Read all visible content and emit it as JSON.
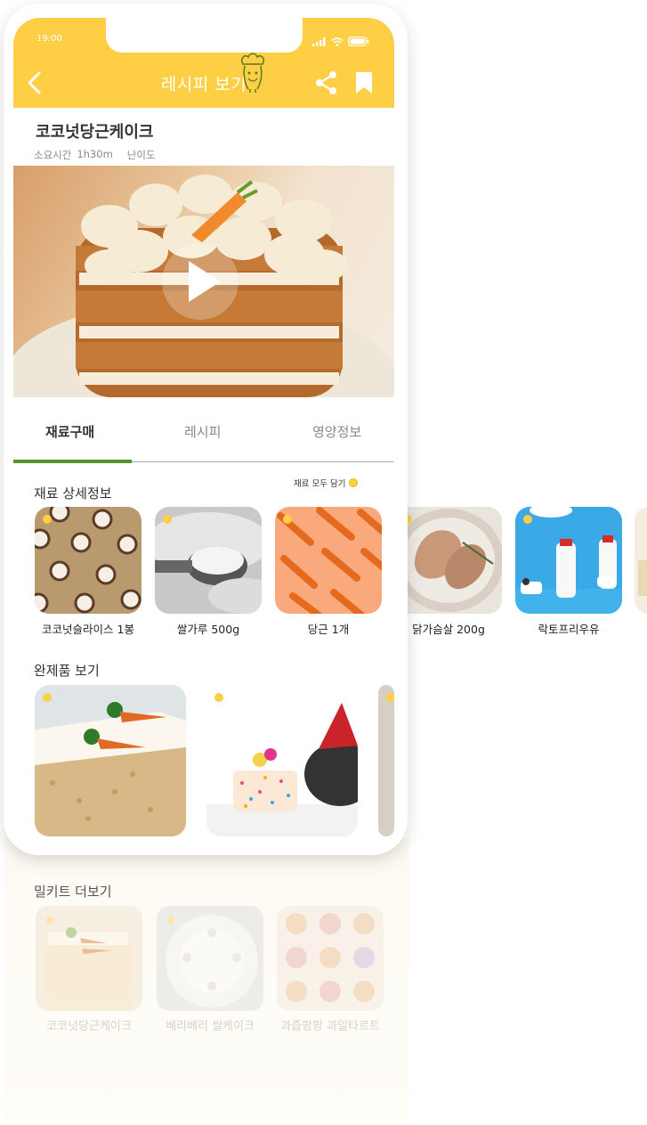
{
  "status_bar": {
    "time": "19:00"
  },
  "app_bar": {
    "title": "레시피 보기"
  },
  "recipe": {
    "title": "코코넛당근케이크",
    "time_label": "소요시간",
    "time_value": "1h30m",
    "difficulty_label": "난이도"
  },
  "tabs": [
    {
      "label": "재료구매",
      "active": true
    },
    {
      "label": "레시피",
      "active": false
    },
    {
      "label": "영양정보",
      "active": false
    }
  ],
  "ingredients": {
    "title": "재료 상세정보",
    "add_all_label": "재료 모두 담기",
    "items": [
      {
        "label": "코코넛슬라이스 1봉",
        "image": "coconut-slices"
      },
      {
        "label": "쌀가루 500g",
        "image": "rice-flour"
      },
      {
        "label": "당근 1개",
        "image": "carrots"
      },
      {
        "label": "닭가슴살 200g",
        "image": "chicken-breast"
      },
      {
        "label": "락토프리우유",
        "image": "lactose-free-milk"
      }
    ]
  },
  "finished": {
    "title": "완제품 보기",
    "items": [
      {
        "image": "carrot-cake"
      },
      {
        "image": "dog-birthday-cake"
      }
    ]
  },
  "meal_kits": {
    "title": "밀키트 더보기",
    "items": [
      {
        "label": "코코넛당근케이크"
      },
      {
        "label": "베리베리 쌀케이크"
      },
      {
        "label": "과즙팡팡 과일타르트"
      }
    ]
  },
  "colors": {
    "brand_yellow": "#fecf44",
    "tab_green": "#55932d"
  }
}
